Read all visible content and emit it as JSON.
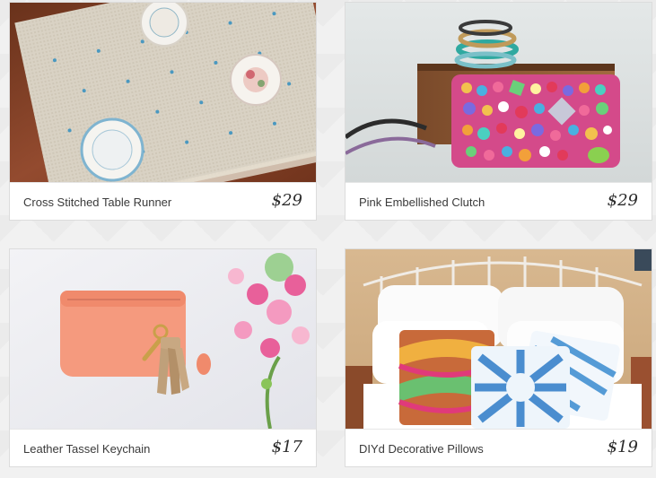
{
  "products": [
    {
      "title": "Cross Stitched Table Runner",
      "price": "$29",
      "image_icon": "table-runner-image"
    },
    {
      "title": "Pink Embellished Clutch",
      "price": "$29",
      "image_icon": "clutch-image"
    },
    {
      "title": "Leather Tassel Keychain",
      "price": "$17",
      "image_icon": "keychain-image"
    },
    {
      "title": "DIYd Decorative Pillows",
      "price": "$19",
      "image_icon": "pillows-image"
    }
  ],
  "colors": {
    "background": "#f1f1f1",
    "card": "#ffffff",
    "text": "#3a3a3a"
  }
}
